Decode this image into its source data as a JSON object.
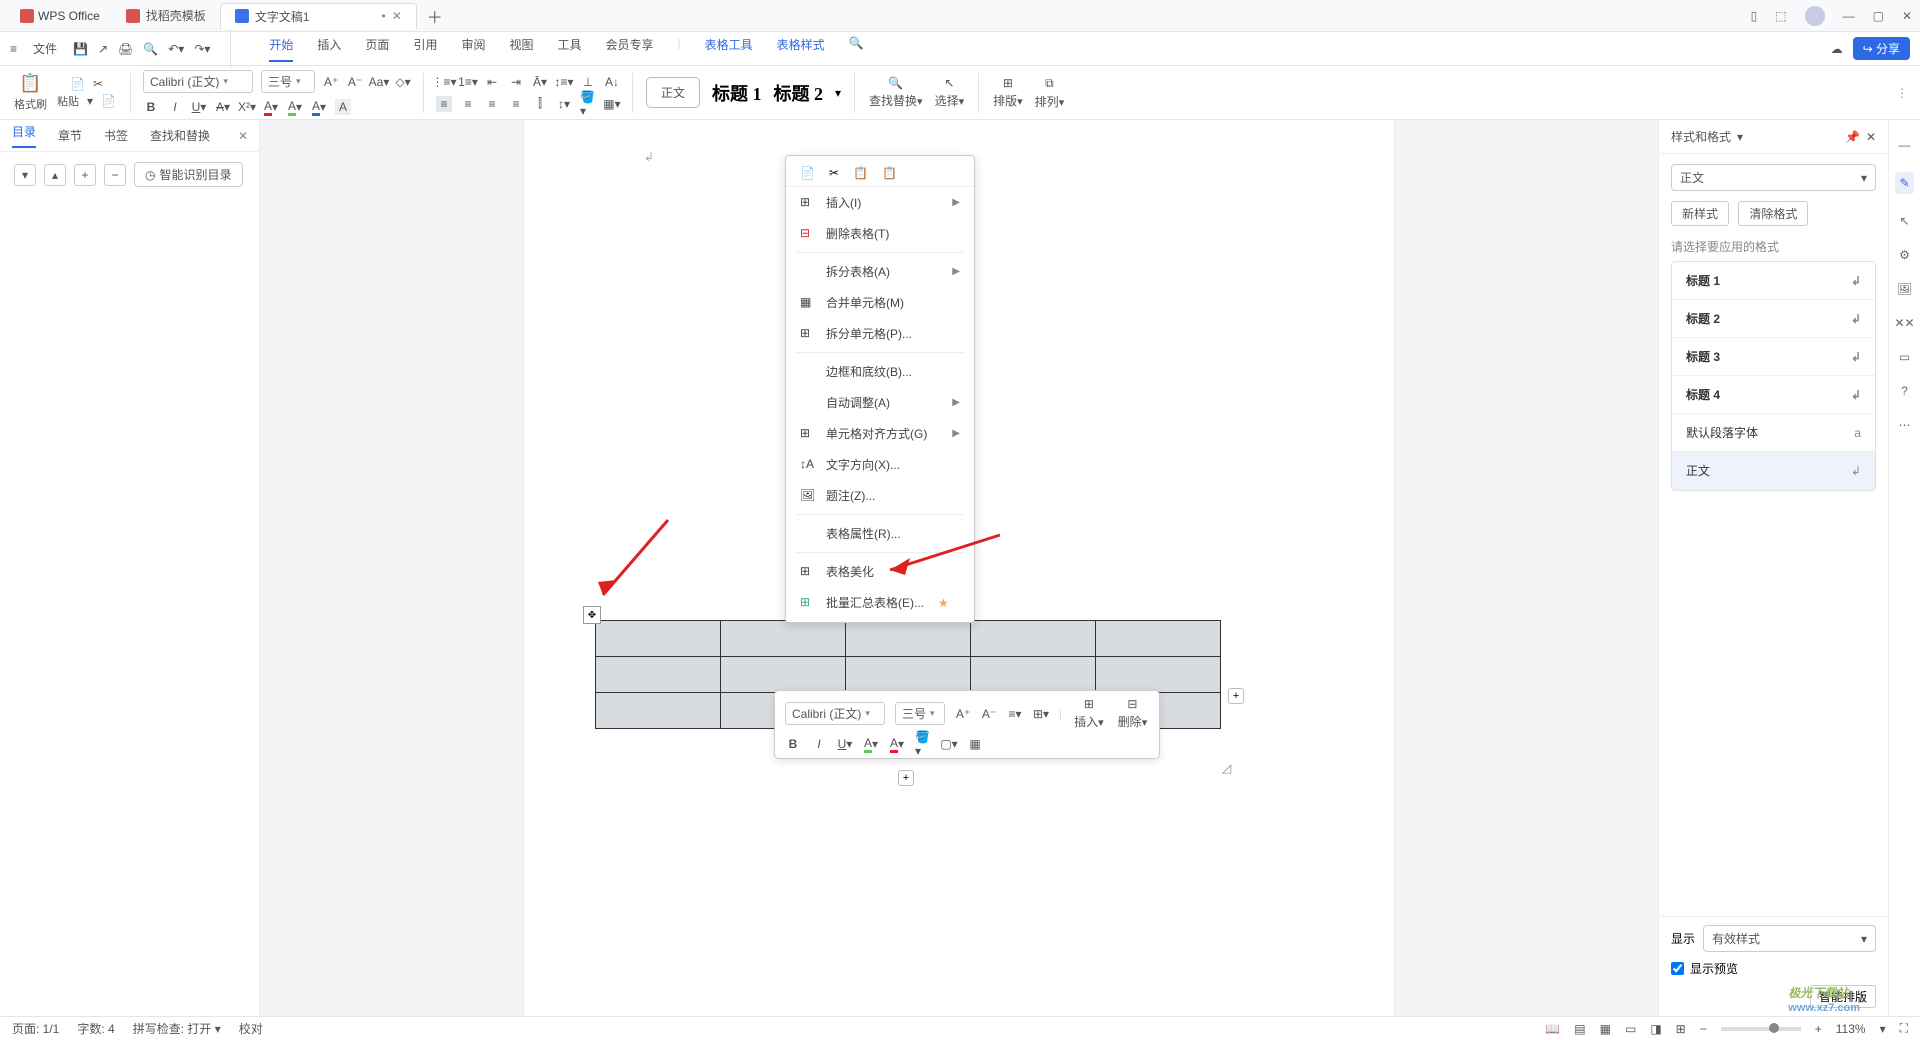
{
  "title": {
    "app": "WPS Office",
    "tab_template": "找稻壳模板",
    "tab_doc": "文字文稿1"
  },
  "menu": {
    "file": "文件",
    "tabs": [
      "开始",
      "插入",
      "页面",
      "引用",
      "审阅",
      "视图",
      "工具",
      "会员专享"
    ],
    "table_tools": "表格工具",
    "table_style": "表格样式",
    "share": "分享"
  },
  "toolbar": {
    "brush": "格式刷",
    "paste": "粘贴",
    "font": "Calibri (正文)",
    "size": "三号",
    "style_normal": "正文",
    "style_h1": "标题 1",
    "style_h2": "标题 2",
    "find": "查找替换",
    "select": "选择",
    "layout": "排版",
    "sort": "排列"
  },
  "nav": {
    "tabs": [
      "目录",
      "章节",
      "书签",
      "查找和替换"
    ],
    "smart": "智能识别目录"
  },
  "context": {
    "insert": "插入(I)",
    "del_table": "删除表格(T)",
    "split_table": "拆分表格(A)",
    "merge": "合并单元格(M)",
    "split_cell": "拆分单元格(P)...",
    "border": "边框和底纹(B)...",
    "autofit": "自动调整(A)",
    "align": "单元格对齐方式(G)",
    "direction": "文字方向(X)...",
    "caption": "题注(Z)...",
    "props": "表格属性(R)...",
    "beautify": "表格美化",
    "batch": "批量汇总表格(E)..."
  },
  "float": {
    "font": "Calibri (正文)",
    "size": "三号",
    "insert": "插入",
    "delete": "删除"
  },
  "right": {
    "title": "样式和格式",
    "current": "正文",
    "new": "新样式",
    "clear": "清除格式",
    "hint": "请选择要应用的格式",
    "items": [
      "标题 1",
      "标题 2",
      "标题 3",
      "标题 4",
      "默认段落字体",
      "正文"
    ],
    "show": "显示",
    "show_val": "有效样式",
    "preview": "显示预览",
    "smart_layout": "智能排版"
  },
  "status": {
    "page": "页面: 1/1",
    "words": "字数: 4",
    "spell": "拼写检查: 打开",
    "proof": "校对",
    "zoom": "113%"
  },
  "watermark": {
    "name": "极光下载站",
    "url": "www.xz7.com"
  }
}
